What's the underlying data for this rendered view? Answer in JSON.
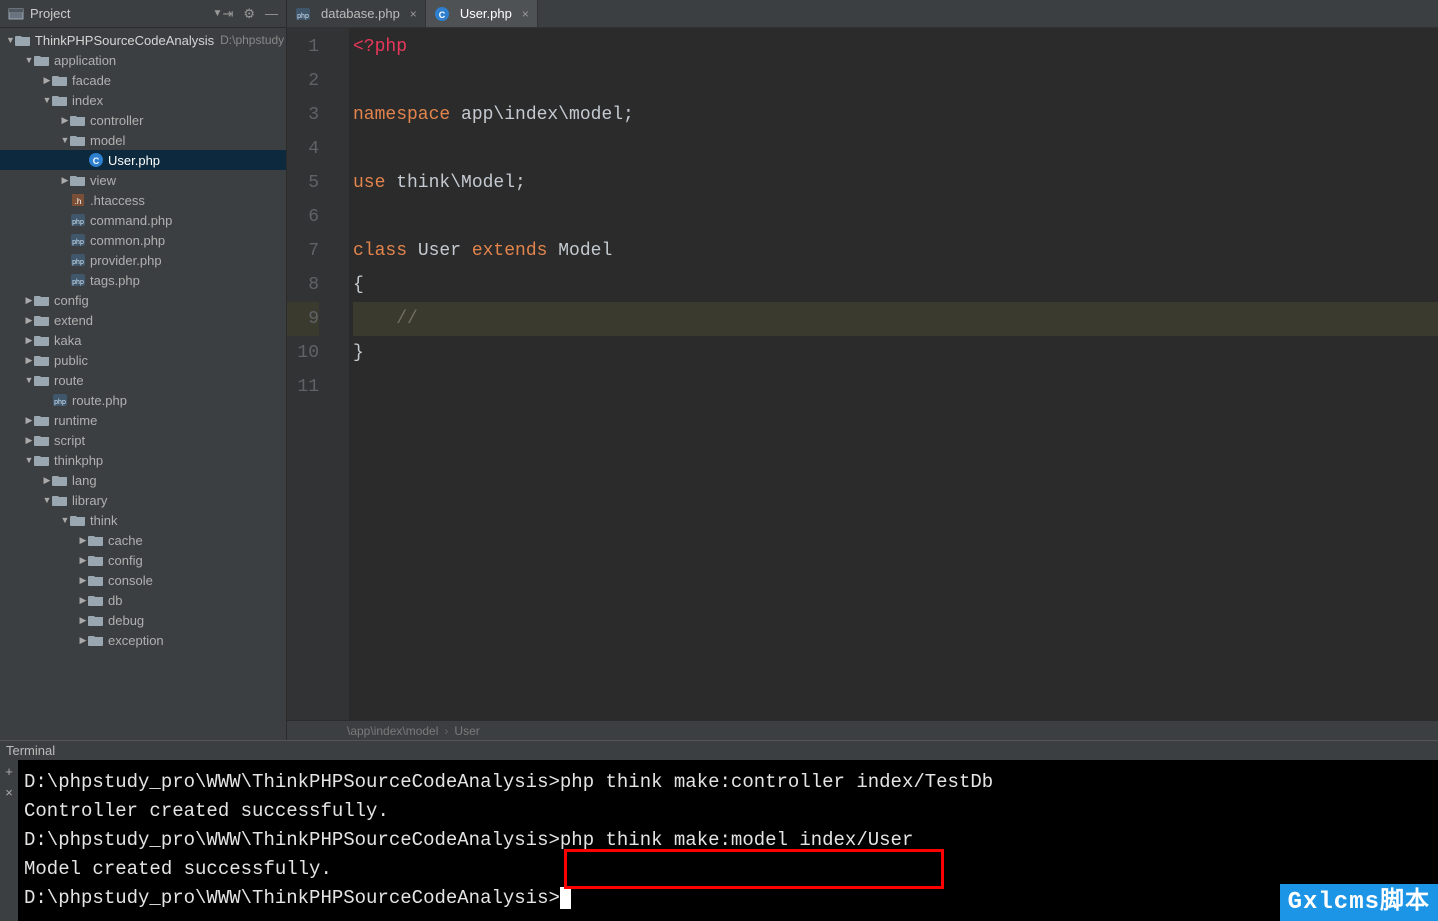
{
  "panel": {
    "title": "Project"
  },
  "project": {
    "root": "ThinkPHPSourceCodeAnalysis",
    "root_path": "D:\\phpstudy"
  },
  "tree": [
    {
      "d": 0,
      "t": "folder",
      "l": "application",
      "exp": true
    },
    {
      "d": 1,
      "t": "folder",
      "l": "facade",
      "exp": false
    },
    {
      "d": 1,
      "t": "folder",
      "l": "index",
      "exp": true
    },
    {
      "d": 2,
      "t": "folder",
      "l": "controller",
      "exp": false
    },
    {
      "d": 2,
      "t": "folder",
      "l": "model",
      "exp": true
    },
    {
      "d": 3,
      "t": "phpclass",
      "l": "User.php",
      "sel": true,
      "leaf": true
    },
    {
      "d": 2,
      "t": "folder",
      "l": "view",
      "exp": false
    },
    {
      "d": 2,
      "t": "htaccess",
      "l": ".htaccess",
      "leaf": true
    },
    {
      "d": 2,
      "t": "php",
      "l": "command.php",
      "leaf": true
    },
    {
      "d": 2,
      "t": "php",
      "l": "common.php",
      "leaf": true
    },
    {
      "d": 2,
      "t": "php",
      "l": "provider.php",
      "leaf": true
    },
    {
      "d": 2,
      "t": "php",
      "l": "tags.php",
      "leaf": true
    },
    {
      "d": 0,
      "t": "folder",
      "l": "config",
      "exp": false
    },
    {
      "d": 0,
      "t": "folder",
      "l": "extend",
      "exp": false
    },
    {
      "d": 0,
      "t": "folder",
      "l": "kaka",
      "exp": false
    },
    {
      "d": 0,
      "t": "folder",
      "l": "public",
      "exp": false
    },
    {
      "d": 0,
      "t": "folder",
      "l": "route",
      "exp": true
    },
    {
      "d": 1,
      "t": "php",
      "l": "route.php",
      "leaf": true
    },
    {
      "d": 0,
      "t": "folder",
      "l": "runtime",
      "exp": false
    },
    {
      "d": 0,
      "t": "folder",
      "l": "script",
      "exp": false
    },
    {
      "d": 0,
      "t": "folder",
      "l": "thinkphp",
      "exp": true
    },
    {
      "d": 1,
      "t": "folder",
      "l": "lang",
      "exp": false
    },
    {
      "d": 1,
      "t": "folder",
      "l": "library",
      "exp": true
    },
    {
      "d": 2,
      "t": "folder",
      "l": "think",
      "exp": true
    },
    {
      "d": 3,
      "t": "folder",
      "l": "cache",
      "exp": false
    },
    {
      "d": 3,
      "t": "folder",
      "l": "config",
      "exp": false
    },
    {
      "d": 3,
      "t": "folder",
      "l": "console",
      "exp": false
    },
    {
      "d": 3,
      "t": "folder",
      "l": "db",
      "exp": false
    },
    {
      "d": 3,
      "t": "folder",
      "l": "debug",
      "exp": false
    },
    {
      "d": 3,
      "t": "folder",
      "l": "exception",
      "exp": false
    }
  ],
  "tabs": [
    {
      "label": "database.php",
      "icon": "php",
      "active": false
    },
    {
      "label": "User.php",
      "icon": "phpclass",
      "active": true
    }
  ],
  "code_lines": [
    {
      "n": 1,
      "seg": [
        {
          "c": "k-tag",
          "t": "<?php"
        }
      ]
    },
    {
      "n": 2,
      "seg": []
    },
    {
      "n": 3,
      "seg": [
        {
          "c": "k-ns",
          "t": "namespace"
        },
        {
          "c": "txt",
          "t": " app\\index\\model;"
        }
      ]
    },
    {
      "n": 4,
      "seg": []
    },
    {
      "n": 5,
      "seg": [
        {
          "c": "k-use",
          "t": "use"
        },
        {
          "c": "txt",
          "t": " think\\Model;"
        }
      ]
    },
    {
      "n": 6,
      "seg": []
    },
    {
      "n": 7,
      "seg": [
        {
          "c": "k-class",
          "t": "class"
        },
        {
          "c": "txt",
          "t": " User "
        },
        {
          "c": "k-ext",
          "t": "extends"
        },
        {
          "c": "txt",
          "t": " Model"
        }
      ]
    },
    {
      "n": 8,
      "seg": [
        {
          "c": "txt",
          "t": "{"
        }
      ]
    },
    {
      "n": 9,
      "hl": true,
      "seg": [
        {
          "c": "txt",
          "t": "    "
        },
        {
          "c": "k-comment",
          "t": "//"
        }
      ]
    },
    {
      "n": 10,
      "seg": [
        {
          "c": "txt",
          "t": "}"
        }
      ]
    },
    {
      "n": 11,
      "seg": []
    }
  ],
  "breadcrumb": {
    "path": "\\app\\index\\model",
    "leaf": "User"
  },
  "terminal": {
    "title": "Terminal",
    "lines": [
      "D:\\phpstudy_pro\\WWW\\ThinkPHPSourceCodeAnalysis>php think make:controller index/TestDb",
      "Controller created successfully.",
      "",
      "D:\\phpstudy_pro\\WWW\\ThinkPHPSourceCodeAnalysis>php think make:model index/User",
      "Model created successfully.",
      "",
      "D:\\phpstudy_pro\\WWW\\ThinkPHPSourceCodeAnalysis>"
    ],
    "highlight_line": 3,
    "highlight_text": "php think make:model index/User"
  },
  "watermark": "Gxlcms脚本"
}
